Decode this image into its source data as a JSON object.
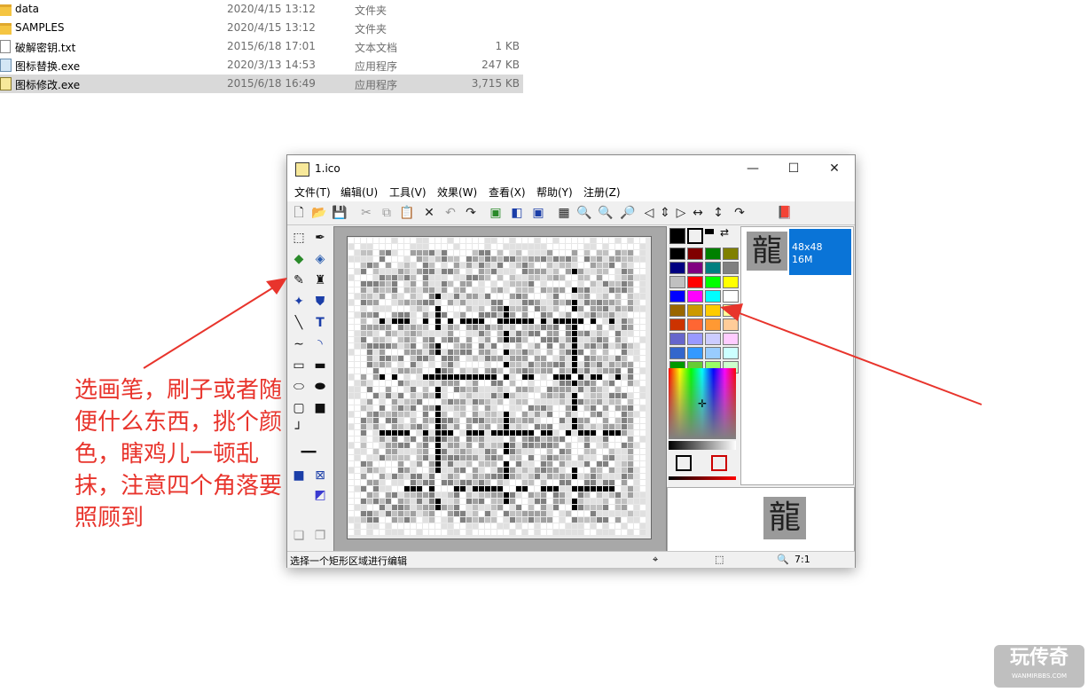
{
  "explorer": {
    "files": [
      {
        "name": "data",
        "date": "2020/4/15 13:12",
        "type": "文件夹",
        "size": "",
        "icon": "folder-icon"
      },
      {
        "name": "SAMPLES",
        "date": "2020/4/15 13:12",
        "type": "文件夹",
        "size": "",
        "icon": "folder-icon"
      },
      {
        "name": "破解密钥.txt",
        "date": "2015/6/18 17:01",
        "type": "文本文档",
        "size": "1 KB",
        "icon": "text-file-icon"
      },
      {
        "name": "图标替换.exe",
        "date": "2020/3/13 14:53",
        "type": "应用程序",
        "size": "247 KB",
        "icon": "app-icon"
      },
      {
        "name": "图标修改.exe",
        "date": "2015/6/18 16:49",
        "type": "应用程序",
        "size": "3,715 KB",
        "icon": "icon-editor-icon"
      }
    ]
  },
  "window": {
    "title": "1.ico",
    "controls": {
      "minimize": "—",
      "maximize": "☐",
      "close": "✕"
    },
    "menu": [
      "文件(T)",
      "编辑(U)",
      "工具(V)",
      "效果(W)",
      "查看(X)",
      "帮助(Y)",
      "注册(Z)"
    ],
    "status": {
      "message": "选择一个矩形区域进行编辑",
      "zoom": "7:1"
    },
    "preview": {
      "glyph": "龍",
      "size_label": "48x48",
      "color_label": "16M"
    }
  },
  "annotation": {
    "text": "选画笔，刷子或者随便什么东西，挑个颜色，瞎鸡儿一顿乱抹，注意四个角落要照顾到",
    "color": "#e8342c"
  },
  "watermark": {
    "title": "玩传奇",
    "subtitle": "WANMIRBBS.COM"
  },
  "palette": {
    "colors": [
      "#000000",
      "#800000",
      "#008000",
      "#808000",
      "#000080",
      "#800080",
      "#008080",
      "#808080",
      "#c0c0c0",
      "#ff0000",
      "#00ff00",
      "#ffff00",
      "#0000ff",
      "#ff00ff",
      "#00ffff",
      "#ffffff",
      "#996600",
      "#cc9900",
      "#ffcc00",
      "#ffff99",
      "#cc3300",
      "#ff6633",
      "#ff9933",
      "#ffcc99",
      "#6666cc",
      "#9999ff",
      "#ccccff",
      "#ffccff",
      "#3366cc",
      "#3399ff",
      "#99ccff",
      "#ccffff",
      "#009900",
      "#66cc33",
      "#99ff66",
      "#ccffcc"
    ]
  }
}
